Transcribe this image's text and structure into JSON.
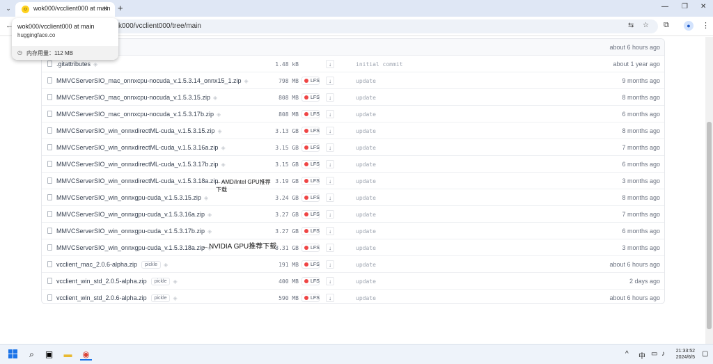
{
  "browser": {
    "tab_title": "wok000/vcclient000 at main",
    "url_visible": "k000/vcclient000/tree/main",
    "new_tab": "+"
  },
  "popup": {
    "title": "wok000/vcclient000 at main",
    "domain": "huggingface.co",
    "memory": "内存用量：112 MB"
  },
  "table": {
    "header_date": "about 6 hours ago",
    "rows": [
      {
        "name": ".gitattributes",
        "size": "1.48 kB",
        "lfs": false,
        "commit": "initial commit",
        "date": "about 1 year ago"
      },
      {
        "name": "MMVCServerSIO_mac_onnxcpu-nocuda_v.1.5.3.14_onnx15_1.zip",
        "size": "798 MB",
        "lfs": true,
        "commit": "update",
        "date": "9 months ago"
      },
      {
        "name": "MMVCServerSIO_mac_onnxcpu-nocuda_v.1.5.3.15.zip",
        "size": "808 MB",
        "lfs": true,
        "commit": "update",
        "date": "8 months ago"
      },
      {
        "name": "MMVCServerSIO_mac_onnxcpu-nocuda_v.1.5.3.17b.zip",
        "size": "808 MB",
        "lfs": true,
        "commit": "update",
        "date": "6 months ago"
      },
      {
        "name": "MMVCServerSIO_win_onnxdirectML-cuda_v.1.5.3.15.zip",
        "size": "3.13 GB",
        "lfs": true,
        "commit": "update",
        "date": "8 months ago"
      },
      {
        "name": "MMVCServerSIO_win_onnxdirectML-cuda_v.1.5.3.16a.zip",
        "size": "3.15 GB",
        "lfs": true,
        "commit": "update",
        "date": "7 months ago"
      },
      {
        "name": "MMVCServerSIO_win_onnxdirectML-cuda_v.1.5.3.17b.zip",
        "size": "3.15 GB",
        "lfs": true,
        "commit": "update",
        "date": "6 months ago"
      },
      {
        "name": "MMVCServerSIO_win_onnxdirectML-cuda_v.1.5.3.18a.zip",
        "size": "3.19 GB",
        "lfs": true,
        "commit": "update",
        "date": "3 months ago"
      },
      {
        "name": "MMVCServerSIO_win_onnxgpu-cuda_v.1.5.3.15.zip",
        "size": "3.24 GB",
        "lfs": true,
        "commit": "update",
        "date": "8 months ago"
      },
      {
        "name": "MMVCServerSIO_win_onnxgpu-cuda_v.1.5.3.16a.zip",
        "size": "3.27 GB",
        "lfs": true,
        "commit": "update",
        "date": "7 months ago"
      },
      {
        "name": "MMVCServerSIO_win_onnxgpu-cuda_v.1.5.3.17b.zip",
        "size": "3.27 GB",
        "lfs": true,
        "commit": "update",
        "date": "6 months ago"
      },
      {
        "name": "MMVCServerSIO_win_onnxgpu-cuda_v.1.5.3.18a.zip",
        "size": "3.31 GB",
        "lfs": true,
        "commit": "update",
        "date": "3 months ago"
      },
      {
        "name": "vcclient_mac_2.0.6-alpha.zip",
        "size": "191 MB",
        "lfs": true,
        "pickle": "pickle",
        "commit": "update",
        "date": "about 6 hours ago"
      },
      {
        "name": "vcclient_win_std_2.0.5-alpha.zip",
        "size": "400 MB",
        "lfs": true,
        "pickle": "pickle",
        "commit": "update",
        "date": "2 days ago"
      },
      {
        "name": "vcclient_win_std_2.0.6-alpha.zip",
        "size": "590 MB",
        "lfs": true,
        "pickle": "pickle",
        "commit": "update",
        "date": "about 6 hours ago"
      }
    ],
    "lfs_label": "LFS"
  },
  "annotations": {
    "amd_line1": "←AMD/Intel GPU推荐",
    "amd_line2": "下载",
    "nvidia": "←NVIDIA GPU推荐下载"
  },
  "taskbar": {
    "ime": "中",
    "time": "21:33:52",
    "date": "2024/6/5"
  },
  "colors": {
    "accent": "#1a73e8",
    "lfs_dot": "#ef4444",
    "hf_yellow": "#ffd21e"
  }
}
